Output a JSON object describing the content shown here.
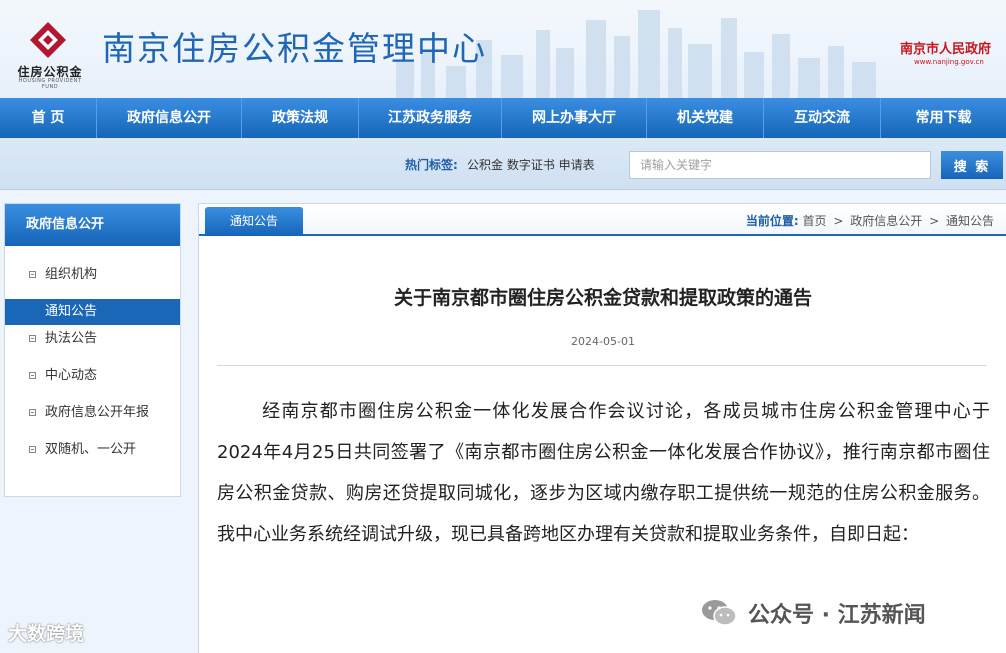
{
  "header": {
    "logo_text": "住房公积金",
    "logo_subtext": "HOUSING PROVIDENT FUND",
    "site_title": "南京住房公积金管理中心",
    "gov_name": "南京市人民政府",
    "gov_url": "www.nanjing.gov.cn"
  },
  "nav": {
    "items": [
      {
        "label": "首 页"
      },
      {
        "label": "政府信息公开"
      },
      {
        "label": "政策法规"
      },
      {
        "label": "江苏政务服务"
      },
      {
        "label": "网上办事大厅"
      },
      {
        "label": "机关党建"
      },
      {
        "label": "互动交流"
      },
      {
        "label": "常用下载"
      }
    ]
  },
  "search": {
    "hot_label": "热门标签:",
    "hot_tags": "公积金 数字证书 申请表",
    "placeholder": "请输入关键字",
    "button_label": "搜 索"
  },
  "sidebar": {
    "title": "政府信息公开",
    "items": [
      {
        "label": "组织机构"
      },
      {
        "label": "通知公告"
      },
      {
        "label": "执法公告"
      },
      {
        "label": "中心动态"
      },
      {
        "label": "政府信息公开年报"
      },
      {
        "label": "双随机、一公开"
      }
    ]
  },
  "main": {
    "tab_label": "通知公告",
    "breadcrumb": {
      "label": "当前位置:",
      "items": [
        "首页",
        "政府信息公开",
        "通知公告"
      ],
      "separator": ">"
    },
    "article": {
      "title": "关于南京都市圈住房公积金贷款和提取政策的通告",
      "date": "2024-05-01",
      "body": "经南京都市圈住房公积金一体化发展合作会议讨论，各成员城市住房公积金管理中心于2024年4月25日共同签署了《南京都市圈住房公积金一体化发展合作协议》，推行南京都市圈住房公积金贷款、购房还贷提取同城化，逐步为区域内缴存职工提供统一规范的住房公积金服务。我中心业务系统经调试升级，现已具备跨地区办理有关贷款和提取业务条件，自即日起："
    }
  },
  "watermarks": {
    "left": "大数跨境",
    "right": "公众号 · 江苏新闻"
  },
  "colors": {
    "brand_blue": "#1a67b8",
    "title_blue": "#1f66b6",
    "gov_red": "#c7161d",
    "logo_red": "#b3172d"
  }
}
